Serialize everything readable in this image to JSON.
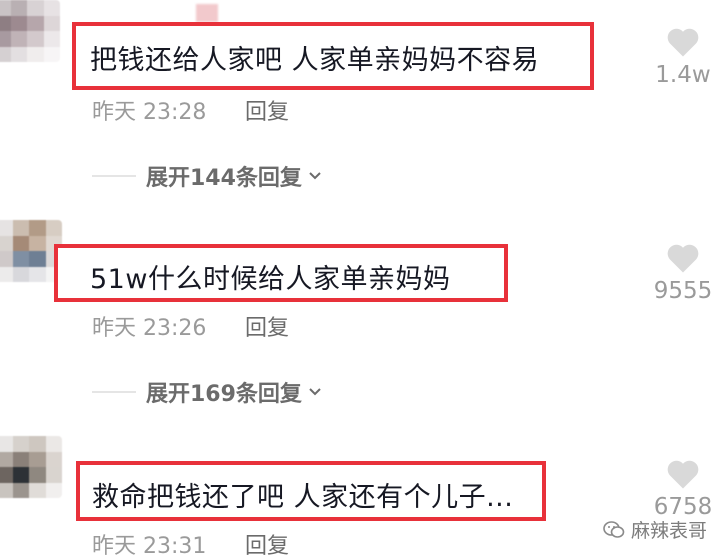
{
  "comments": [
    {
      "text": "把钱还给人家吧 人家单亲妈妈不容易",
      "time": "昨天 23:28",
      "reply_label": "回复",
      "likes": "1.4w",
      "expand": "展开144条回复"
    },
    {
      "text": "51w什么时候给人家单亲妈妈",
      "time": "昨天 23:26",
      "reply_label": "回复",
      "likes": "9555",
      "expand": "展开169条回复"
    },
    {
      "text": "救命把钱还了吧 人家还有个儿子...",
      "time": "昨天 23:31",
      "reply_label": "回复",
      "likes": "6758"
    }
  ],
  "watermark": {
    "text": "麻辣表哥"
  },
  "colors": {
    "highlight": "#e8313a",
    "muted": "#9a9a9a"
  }
}
